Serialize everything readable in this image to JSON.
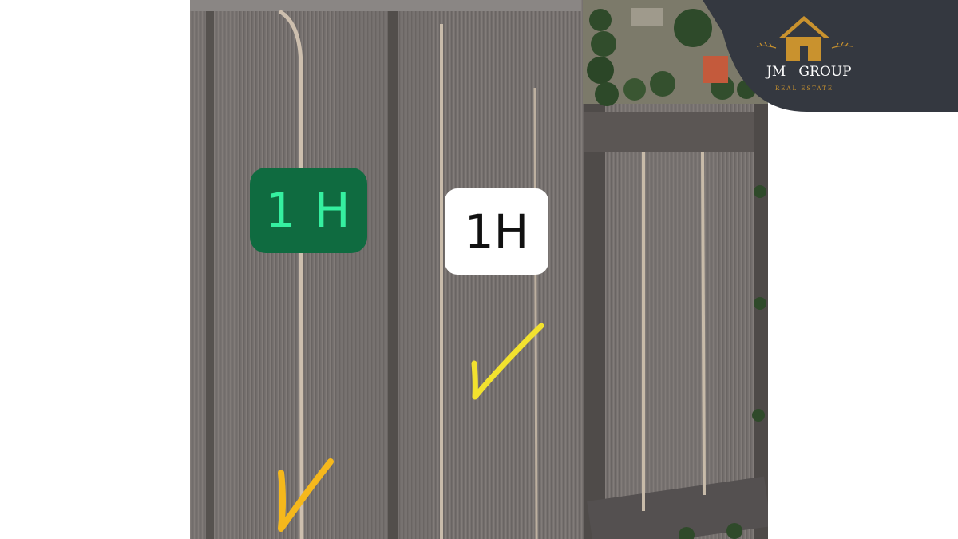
{
  "map": {
    "labels": [
      {
        "text": "1 H",
        "style": "green"
      },
      {
        "text": "1H",
        "style": "white"
      }
    ],
    "checkmarks": [
      {
        "color": "#f2e22e"
      },
      {
        "color": "#f5b81c"
      }
    ]
  },
  "logo": {
    "name": "JM   GROUP",
    "subtitle": "REAL ESTATE",
    "icon": "house-icon",
    "colors": {
      "panel": "#343840",
      "accent": "#c9922e",
      "text": "#ffffff"
    }
  }
}
